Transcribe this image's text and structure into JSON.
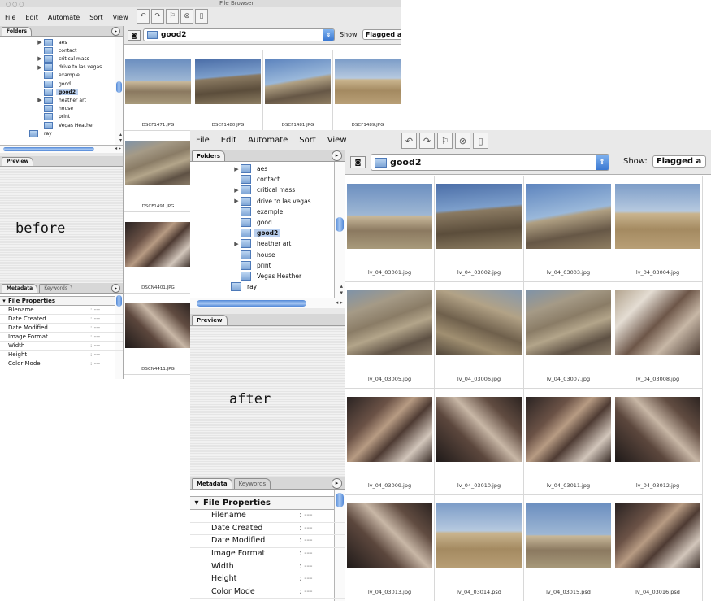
{
  "before": {
    "window_title": "File Browser",
    "menu": [
      "File",
      "Edit",
      "Automate",
      "Sort",
      "View"
    ],
    "folders_tab": "Folders",
    "folders": [
      {
        "name": "aes",
        "expandable": true
      },
      {
        "name": "contact",
        "expandable": false
      },
      {
        "name": "critical mass",
        "expandable": true
      },
      {
        "name": "drive to las vegas",
        "expandable": true
      },
      {
        "name": "example",
        "expandable": false
      },
      {
        "name": "good",
        "expandable": false
      },
      {
        "name": "good2",
        "expandable": false,
        "selected": true
      },
      {
        "name": "heather art",
        "expandable": true
      },
      {
        "name": "house",
        "expandable": false
      },
      {
        "name": "print",
        "expandable": false
      },
      {
        "name": "Vegas Heather",
        "expandable": false
      },
      {
        "name": "ray",
        "expandable": false
      }
    ],
    "preview_tab": "Preview",
    "label": "before",
    "metadata_tab": "Metadata",
    "keywords_tab": "Keywords",
    "file_properties": "File Properties",
    "properties": [
      {
        "key": "Filename",
        "value": ": ---"
      },
      {
        "key": "Date Created",
        "value": ": ---"
      },
      {
        "key": "Date Modified",
        "value": ": ---"
      },
      {
        "key": "Image Format",
        "value": ": ---"
      },
      {
        "key": "Width",
        "value": ": ---"
      },
      {
        "key": "Height",
        "value": ": ---"
      },
      {
        "key": "Color Mode",
        "value": ": ---"
      }
    ],
    "path": "good2",
    "show_label": "Show:",
    "show_value": "Flagged a",
    "thumbnails": [
      {
        "caption": "DSCF1471.JPG",
        "style": "desert-a"
      },
      {
        "caption": "DSCF1480.JPG",
        "style": "desert-b"
      },
      {
        "caption": "DSCF1481.JPG",
        "style": "desert-c"
      },
      {
        "caption": "DSCF1489.JPG",
        "style": "desert-d"
      },
      {
        "caption": "DSCF1491.JPG",
        "style": "badlands"
      },
      {
        "caption": "DSCN4401.JPG",
        "style": "cave"
      },
      {
        "caption": "DSCN4411.JPG",
        "style": "cave2"
      }
    ]
  },
  "after": {
    "menu": [
      "File",
      "Edit",
      "Automate",
      "Sort",
      "View"
    ],
    "folders_tab": "Folders",
    "folders": [
      {
        "name": "aes",
        "expandable": true
      },
      {
        "name": "contact",
        "expandable": false
      },
      {
        "name": "critical mass",
        "expandable": true
      },
      {
        "name": "drive to las vegas",
        "expandable": true
      },
      {
        "name": "example",
        "expandable": false
      },
      {
        "name": "good",
        "expandable": false
      },
      {
        "name": "good2",
        "expandable": false,
        "selected": true
      },
      {
        "name": "heather art",
        "expandable": true
      },
      {
        "name": "house",
        "expandable": false
      },
      {
        "name": "print",
        "expandable": false
      },
      {
        "name": "Vegas Heather",
        "expandable": false
      },
      {
        "name": "ray",
        "expandable": false
      }
    ],
    "preview_tab": "Preview",
    "label": "after",
    "metadata_tab": "Metadata",
    "keywords_tab": "Keywords",
    "file_properties": "File Properties",
    "properties": [
      {
        "key": "Filename",
        "value": ": ---"
      },
      {
        "key": "Date Created",
        "value": ": ---"
      },
      {
        "key": "Date Modified",
        "value": ": ---"
      },
      {
        "key": "Image Format",
        "value": ": ---"
      },
      {
        "key": "Width",
        "value": ": ---"
      },
      {
        "key": "Height",
        "value": ": ---"
      },
      {
        "key": "Color Mode",
        "value": ": ---"
      }
    ],
    "path": "good2",
    "show_label": "Show:",
    "show_value": "Flagged a",
    "thumbnails": [
      {
        "caption": "lv_04_03001.jpg",
        "style": "desert-a"
      },
      {
        "caption": "lv_04_03002.jpg",
        "style": "desert-b"
      },
      {
        "caption": "lv_04_03003.jpg",
        "style": "desert-c"
      },
      {
        "caption": "lv_04_03004.jpg",
        "style": "desert-d"
      },
      {
        "caption": "lv_04_03005.jpg",
        "style": "badlands"
      },
      {
        "caption": "lv_04_03006.jpg",
        "style": "badlands2"
      },
      {
        "caption": "lv_04_03007.jpg",
        "style": "badlands"
      },
      {
        "caption": "lv_04_03008.jpg",
        "style": "crowd"
      },
      {
        "caption": "lv_04_03009.jpg",
        "style": "cave"
      },
      {
        "caption": "lv_04_03010.jpg",
        "style": "cave2"
      },
      {
        "caption": "lv_04_03011.jpg",
        "style": "cave"
      },
      {
        "caption": "lv_04_03012.jpg",
        "style": "cave2"
      },
      {
        "caption": "lv_04_03013.jpg",
        "style": "cave2"
      },
      {
        "caption": "lv_04_03014.psd",
        "style": "desert-d"
      },
      {
        "caption": "lv_04_03015.psd",
        "style": "desert-a"
      },
      {
        "caption": "lv_04_03016.psd",
        "style": "cave"
      }
    ]
  }
}
